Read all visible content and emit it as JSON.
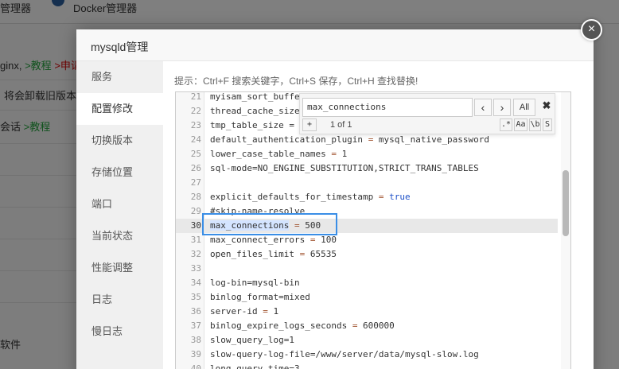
{
  "background": {
    "top_left_text": "管理器",
    "top_right_text": "Docker管理器",
    "line1_prefix": "ginx,",
    "line1_link": ">教程",
    "line1_red": ">申请",
    "line2": "将会卸载旧版本,",
    "line3_prefix": "会话",
    "line3_link": ">教程",
    "line4": "软件"
  },
  "modal": {
    "title": "mysqld管理",
    "close_icon": "×"
  },
  "sidebar": {
    "items": [
      {
        "label": "服务"
      },
      {
        "label": "配置修改"
      },
      {
        "label": "切换版本"
      },
      {
        "label": "存储位置"
      },
      {
        "label": "端口"
      },
      {
        "label": "当前状态"
      },
      {
        "label": "性能调整"
      },
      {
        "label": "日志"
      },
      {
        "label": "慢日志"
      }
    ],
    "active_index": 1
  },
  "hint": "提示：Ctrl+F 搜索关键字，Ctrl+S 保存，Ctrl+H 查找替换!",
  "editor": {
    "lines": [
      {
        "num": "21",
        "code": "myisam_sort_buffe"
      },
      {
        "num": "22",
        "code": "thread_cache_size"
      },
      {
        "num": "23",
        "code": "tmp_table_size ="
      },
      {
        "num": "24",
        "code": "default_authentication_plugin = mysql_native_password"
      },
      {
        "num": "25",
        "code": "lower_case_table_names = 1"
      },
      {
        "num": "26",
        "code": "sql-mode=NO_ENGINE_SUBSTITUTION,STRICT_TRANS_TABLES"
      },
      {
        "num": "27",
        "code": ""
      },
      {
        "num": "28",
        "code": "explicit_defaults_for_timestamp = true"
      },
      {
        "num": "29",
        "code": "#skip-name-resolve"
      },
      {
        "num": "30",
        "code": "max_connections = 500"
      },
      {
        "num": "31",
        "code": "max_connect_errors = 100"
      },
      {
        "num": "32",
        "code": "open_files_limit = 65535"
      },
      {
        "num": "33",
        "code": ""
      },
      {
        "num": "34",
        "code": "log-bin=mysql-bin"
      },
      {
        "num": "35",
        "code": "binlog_format=mixed"
      },
      {
        "num": "36",
        "code": "server-id = 1"
      },
      {
        "num": "37",
        "code": "binlog_expire_logs_seconds = 600000"
      },
      {
        "num": "38",
        "code": "slow_query_log=1"
      },
      {
        "num": "39",
        "code": "slow-query-log-file=/www/server/data/mysql-slow.log"
      },
      {
        "num": "40",
        "code": "long_query_time=3"
      }
    ],
    "active_line": "30"
  },
  "find": {
    "query": "max_connections",
    "prev_label": "‹",
    "next_label": "›",
    "all_label": "All",
    "close_label": "✖",
    "expand_label": "+",
    "count": "1 of 1",
    "regex_label": ".*",
    "case_label": "Aa",
    "word_label": "\\b",
    "selection_label": "S"
  }
}
